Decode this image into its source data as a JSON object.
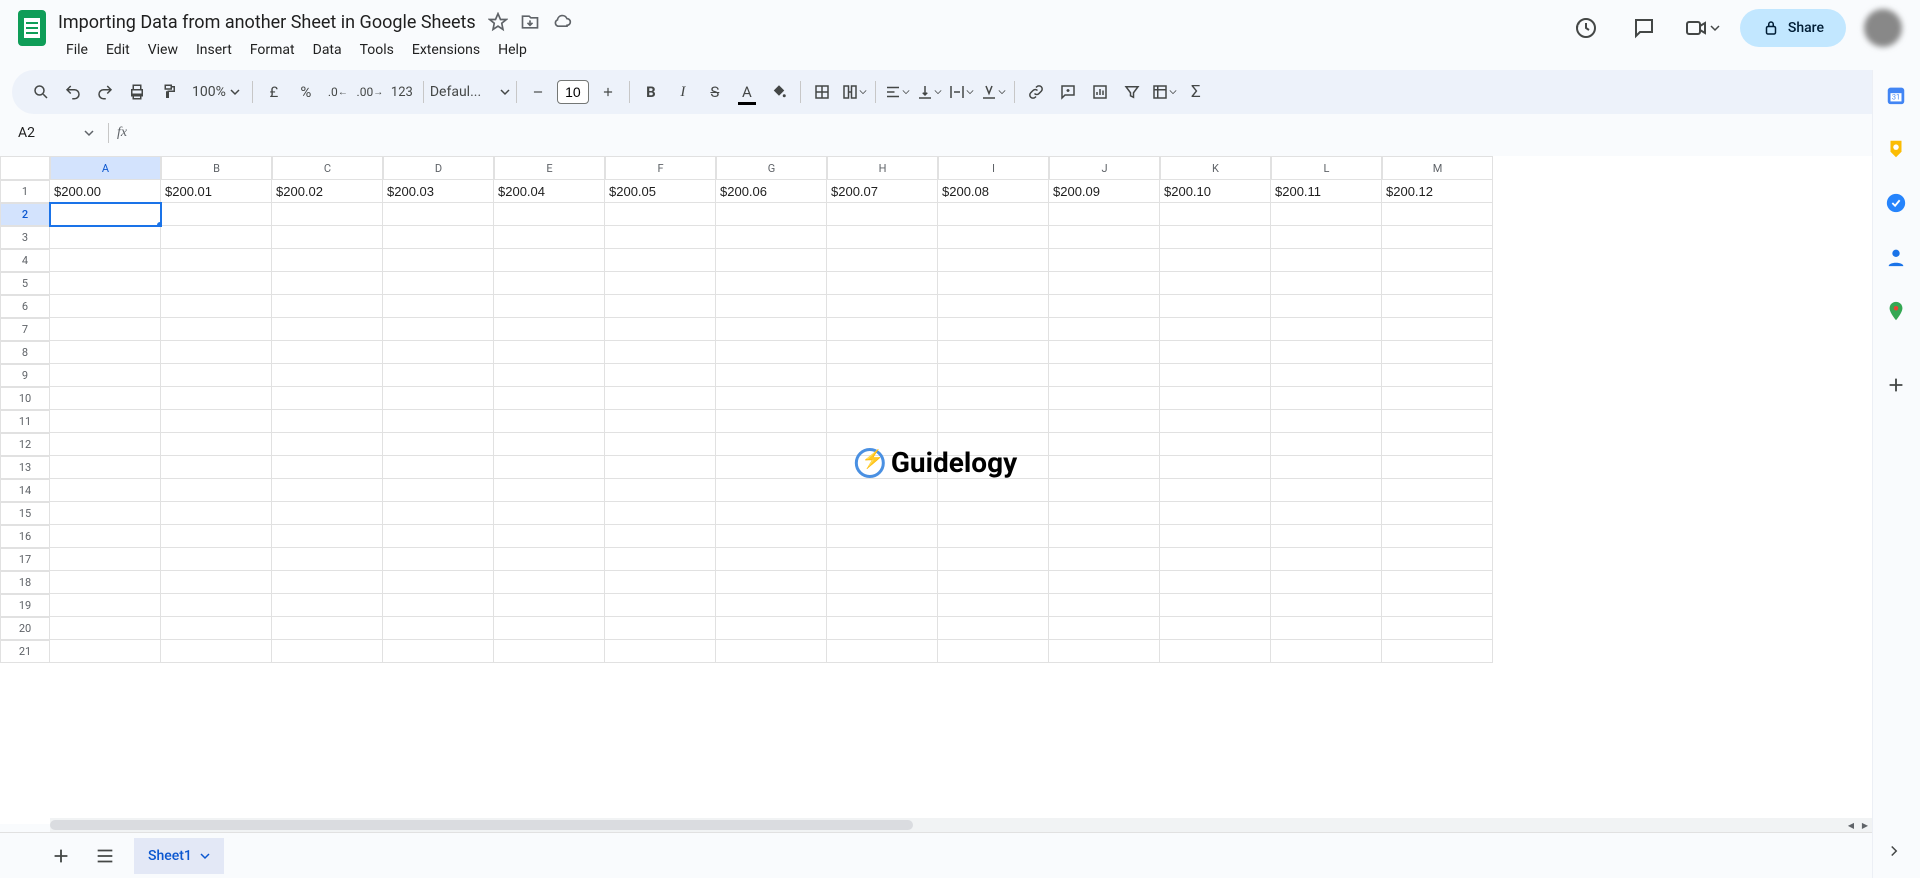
{
  "doc": {
    "title": "Importing Data from another Sheet in Google Sheets"
  },
  "menus": [
    "File",
    "Edit",
    "View",
    "Insert",
    "Format",
    "Data",
    "Tools",
    "Extensions",
    "Help"
  ],
  "share": {
    "label": "Share"
  },
  "toolbar": {
    "zoom": "100%",
    "currency": "£",
    "percent": "%",
    "dec_dec": ".0",
    "inc_dec": ".00",
    "num_fmt": "123",
    "font": "Defaul...",
    "font_size": "10"
  },
  "cellref": {
    "name": "A2",
    "formula": ""
  },
  "columns": [
    "A",
    "B",
    "C",
    "D",
    "E",
    "F",
    "G",
    "H",
    "I",
    "J",
    "K",
    "L",
    "M"
  ],
  "row1": [
    "$200.00",
    "$200.01",
    "$200.02",
    "$200.03",
    "$200.04",
    "$200.05",
    "$200.06",
    "$200.07",
    "$200.08",
    "$200.09",
    "$200.10",
    "$200.11",
    "$200.12"
  ],
  "selected_col": "A",
  "selected_row": 2,
  "visible_rows": 21,
  "watermark": "Guidelogy",
  "sheet_tabs": {
    "active": "Sheet1"
  }
}
